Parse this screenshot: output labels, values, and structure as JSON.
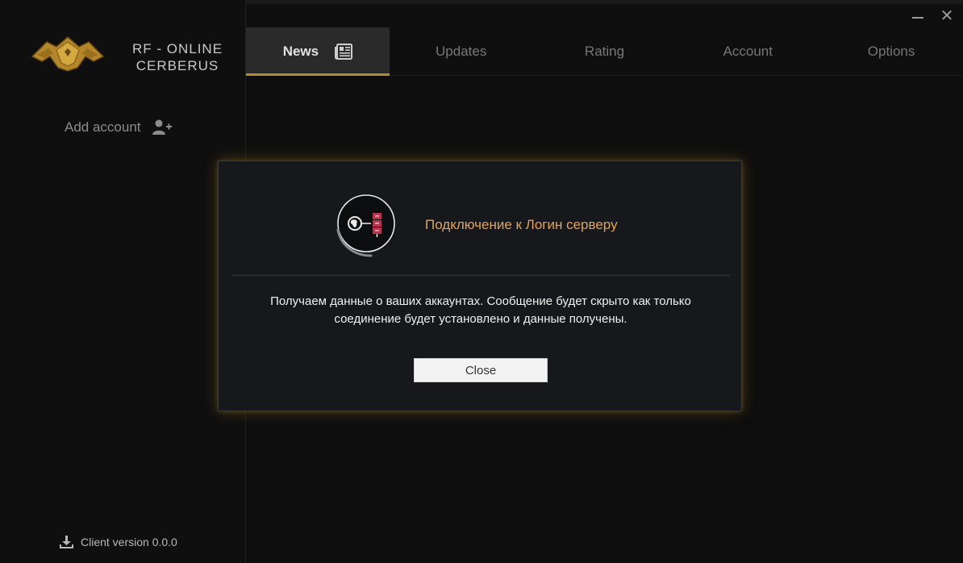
{
  "window": {
    "minimize_icon": "minimize-icon",
    "close_icon": "close-icon",
    "close_glyph": "✕"
  },
  "brand": {
    "line1": "RF - ONLINE",
    "line2": "CERBERUS",
    "logo_icon": "dragon-logo-icon"
  },
  "sidebar": {
    "add_account_label": "Add account",
    "add_account_icon": "user-plus-icon",
    "client_version_label": "Client version 0.0.0",
    "download_icon": "download-icon"
  },
  "tabs": [
    {
      "label": "News",
      "active": true,
      "icon": "newspaper-icon"
    },
    {
      "label": "Updates",
      "active": false
    },
    {
      "label": "Rating",
      "active": false
    },
    {
      "label": "Account",
      "active": false
    },
    {
      "label": "Options",
      "active": false
    }
  ],
  "modal": {
    "title": "Подключение к Логин серверу",
    "message_line1": "Получаем данные о ваших аккаунтах. Сообщение будет скрыто как только",
    "message_line2": "соединение будет установлено и данные получены.",
    "close_label": "Close",
    "icon": "server-connection-icon"
  },
  "colors": {
    "accent_gold": "#b88a2a",
    "modal_title": "#e1a35d",
    "background": "#0f0f0f"
  }
}
